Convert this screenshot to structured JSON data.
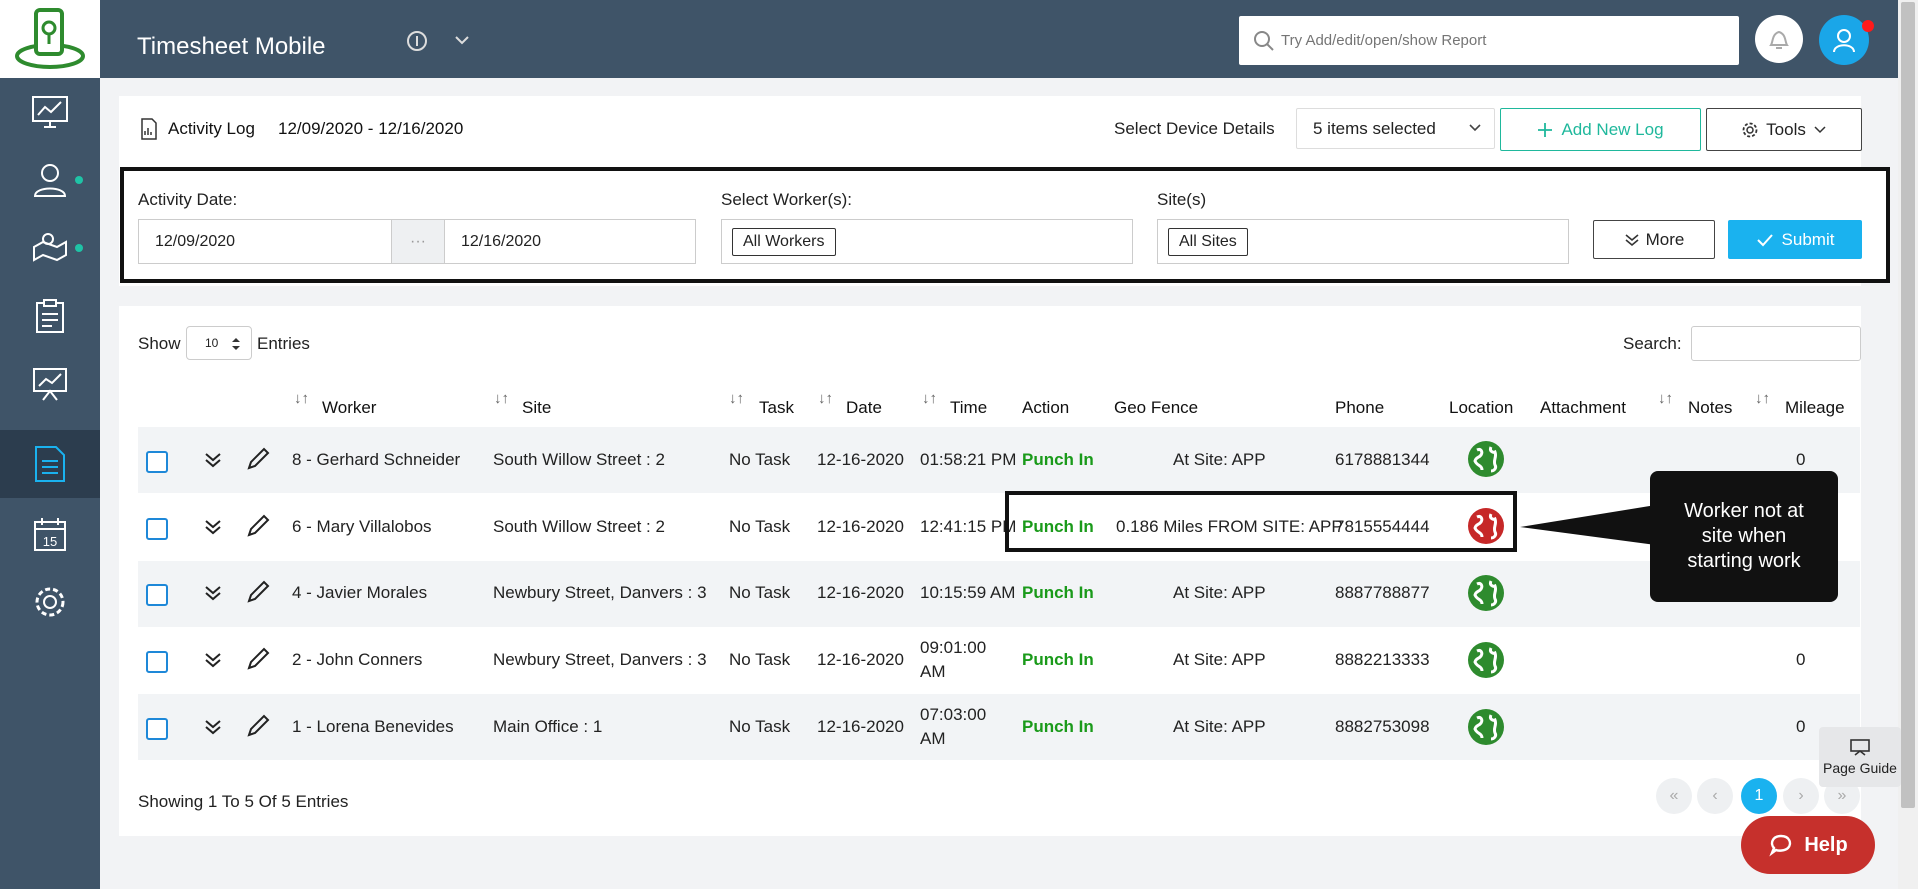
{
  "colors": {
    "sidebar": "#3f5468",
    "accent_teal": "#1fb89c",
    "accent_blue": "#1ab2ef",
    "punch_green": "#1a9a1a",
    "help_red": "#c6302c"
  },
  "header": {
    "app_title": "Timesheet Mobile",
    "search_placeholder": "Try Add/edit/open/show Report"
  },
  "sidebar": {
    "items": [
      {
        "icon": "dashboard-monitor-icon"
      },
      {
        "icon": "workers-icon"
      },
      {
        "icon": "map-sites-icon"
      },
      {
        "icon": "clipboard-tasks-icon"
      },
      {
        "icon": "presentation-chart-icon"
      },
      {
        "icon": "report-document-icon",
        "active": true
      },
      {
        "icon": "calendar-icon",
        "label": "15"
      },
      {
        "icon": "gear-icon"
      }
    ]
  },
  "panel": {
    "title": "Activity Log",
    "range": "12/09/2020 - 12/16/2020",
    "device_label": "Select Device Details",
    "device_value": "5 items selected",
    "add_log": "Add New Log",
    "tools": "Tools"
  },
  "filters": {
    "date_label": "Activity Date:",
    "date_from": "12/09/2020",
    "date_sep": "···",
    "date_to": "12/16/2020",
    "workers_label": "Select Worker(s):",
    "workers_value": "All Workers",
    "sites_label": "Site(s)",
    "sites_value": "All Sites",
    "more": "More",
    "submit": "Submit"
  },
  "table": {
    "show": "Show",
    "entries_value": "10",
    "entries": "Entries",
    "search": "Search:",
    "columns": [
      "Worker",
      "Site",
      "Task",
      "Date",
      "Time",
      "Action",
      "Geo Fence",
      "Phone",
      "Location",
      "Attachment",
      "Notes",
      "Mileage"
    ],
    "rows": [
      {
        "worker": "8 - Gerhard Schneider",
        "site": "South Willow Street : 2",
        "task": "No Task",
        "date": "12-16-2020",
        "time1": "01:58:21 PM",
        "time2": "",
        "action": "Punch In",
        "geo": "At Site: APP",
        "phone": "6178881344",
        "location": "green",
        "mileage": "0"
      },
      {
        "worker": "6 - Mary Villalobos",
        "site": "South Willow Street : 2",
        "task": "No Task",
        "date": "12-16-2020",
        "time1": "12:41:15 PM",
        "time2": "",
        "action": "Punch In",
        "geo": "0.186 Miles FROM SITE: APP",
        "phone": "7815554444",
        "location": "red",
        "mileage": ""
      },
      {
        "worker": "4 - Javier Morales",
        "site": "Newbury Street, Danvers : 3",
        "task": "No Task",
        "date": "12-16-2020",
        "time1": "10:15:59 AM",
        "time2": "",
        "action": "Punch In",
        "geo": "At Site: APP",
        "phone": "8887788877",
        "location": "green",
        "mileage": ""
      },
      {
        "worker": "2 - John Conners",
        "site": "Newbury Street, Danvers : 3",
        "task": "No Task",
        "date": "12-16-2020",
        "time1": "09:01:00",
        "time2": "AM",
        "action": "Punch In",
        "geo": "At Site: APP",
        "phone": "8882213333",
        "location": "green",
        "mileage": "0"
      },
      {
        "worker": "1 - Lorena Benevides",
        "site": "Main Office : 1",
        "task": "No Task",
        "date": "12-16-2020",
        "time1": "07:03:00",
        "time2": "AM",
        "action": "Punch In",
        "geo": "At Site: APP",
        "phone": "8882753098",
        "location": "green",
        "mileage": "0"
      }
    ],
    "showing": "Showing 1 To 5 Of 5 Entries"
  },
  "pagination": {
    "current": "1"
  },
  "callout": "Worker not at site when starting work",
  "page_guide": "Page Guide",
  "help": "Help"
}
